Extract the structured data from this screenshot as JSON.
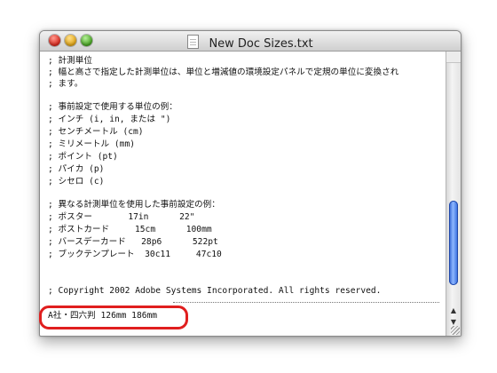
{
  "window": {
    "title": "New Doc Sizes.txt"
  },
  "document": {
    "lines": [
      "; 計測単位",
      "; 幅と高さで指定した計測単位は、単位と増減値の環境設定パネルで定規の単位に変換され",
      "; ます。",
      "",
      "; 事前設定で使用する単位の例：",
      "; インチ (i, in, または \")",
      "; センチメートル (cm)",
      "; ミリメートル (mm)",
      "; ポイント (pt)",
      "; パイカ (p)",
      "; シセロ (c)",
      "",
      "; 異なる計測単位を使用した事前設定の例：",
      "; ポスター       17in      22\"",
      "; ポストカード     15cm      100mm",
      "; バースデーカード   28p6      522pt",
      "; ブックテンプレート  30c11     47c10",
      "",
      "",
      "",
      "; Copyright 2002 Adobe Systems Incorporated. All rights reserved.",
      "",
      "A社・四六判 126mm 186mm"
    ]
  }
}
